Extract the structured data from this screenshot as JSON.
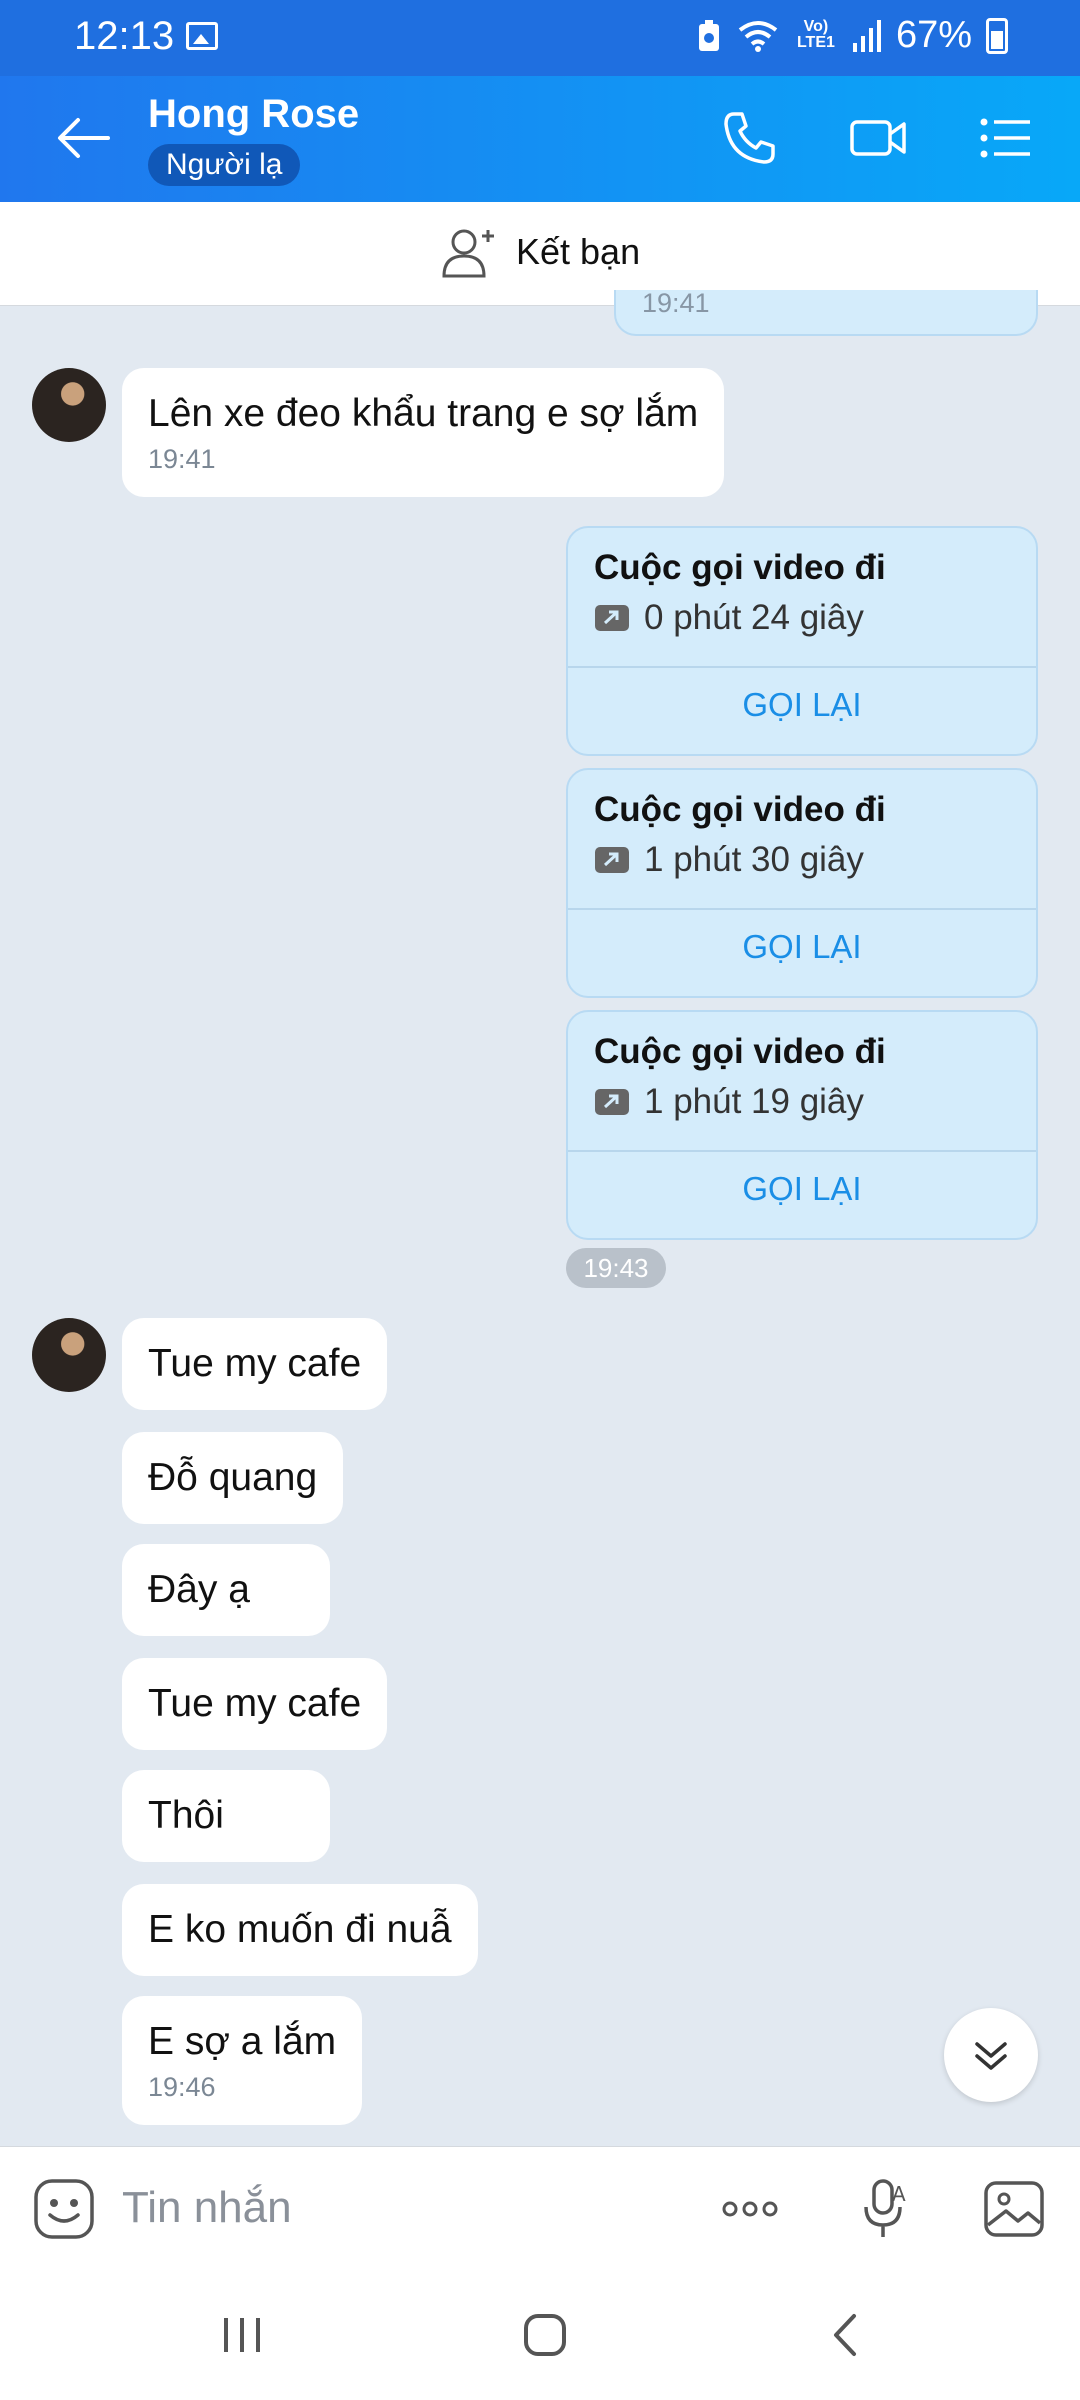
{
  "status": {
    "time": "12:13",
    "lte_top": "Vo)",
    "lte_bottom": "LTE1",
    "battery": "67%"
  },
  "header": {
    "name": "Hong Rose",
    "badge": "Người lạ"
  },
  "friend_bar": {
    "label": "Kết bạn"
  },
  "messages": {
    "partial_time": "19:41",
    "m1_text": "Lên xe đeo khẩu trang e sợ lắm",
    "m1_time": "19:41",
    "calls": [
      {
        "title": "Cuộc gọi video đi",
        "duration": "0 phút 24 giây",
        "redial": "GỌI LẠI"
      },
      {
        "title": "Cuộc gọi video đi",
        "duration": "1 phút 30 giây",
        "redial": "GỌI LẠI"
      },
      {
        "title": "Cuộc gọi video đi",
        "duration": "1 phút 19 giây",
        "redial": "GỌI LẠI"
      }
    ],
    "calls_time": "19:43",
    "group": [
      "Tue my cafe",
      "Đỗ quang",
      "Đây ạ",
      "Tue my cafe",
      "Thôi",
      "E ko muốn đi nuẫ",
      "E sợ a lắm"
    ],
    "group_time": "19:46"
  },
  "input": {
    "placeholder": "Tin nhắn"
  },
  "colors": {
    "header_start": "#2077ee",
    "header_end": "#08a8f8",
    "accent": "#1a8ee6",
    "chat_bg": "#e2e9f1"
  }
}
